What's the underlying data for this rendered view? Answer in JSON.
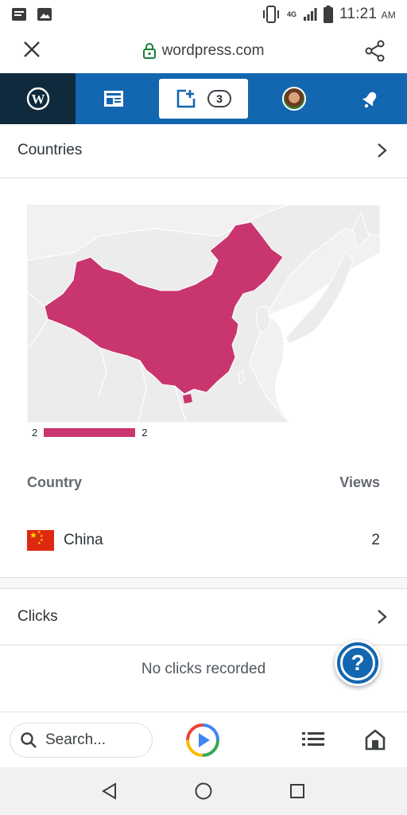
{
  "status_bar": {
    "time": "11:21",
    "ampm": "AM",
    "network": "4G",
    "icons": [
      "message-icon",
      "image-icon",
      "vibrate-icon",
      "signal-icon",
      "battery-icon"
    ]
  },
  "browser": {
    "url": "wordpress.com",
    "icons": [
      "close-icon",
      "lock-icon",
      "share-icon"
    ]
  },
  "wp_nav": {
    "write_badge": "3",
    "icons": [
      "wordpress-logo-icon",
      "reader-icon",
      "write-icon",
      "avatar",
      "notifications-icon"
    ]
  },
  "countries": {
    "title": "Countries",
    "legend_min": "2",
    "legend_max": "2",
    "col_country": "Country",
    "col_views": "Views",
    "rows": [
      {
        "name": "China",
        "views": "2",
        "flag": "china-flag-icon"
      }
    ],
    "highlight_color": "#c9356e"
  },
  "clicks": {
    "title": "Clicks",
    "empty_text": "No clicks recorded"
  },
  "help_label": "?",
  "bottom_bar": {
    "search_text": "Search...",
    "icons": [
      "search-icon",
      "google-play-icon",
      "list-icon",
      "home-icon"
    ]
  },
  "system_nav": {
    "icons": [
      "back-icon",
      "home-circle-icon",
      "recents-icon"
    ]
  },
  "colors": {
    "wp_blue": "#1366b0",
    "wp_dark": "#0f2a3c",
    "map_highlight": "#c9356e"
  }
}
